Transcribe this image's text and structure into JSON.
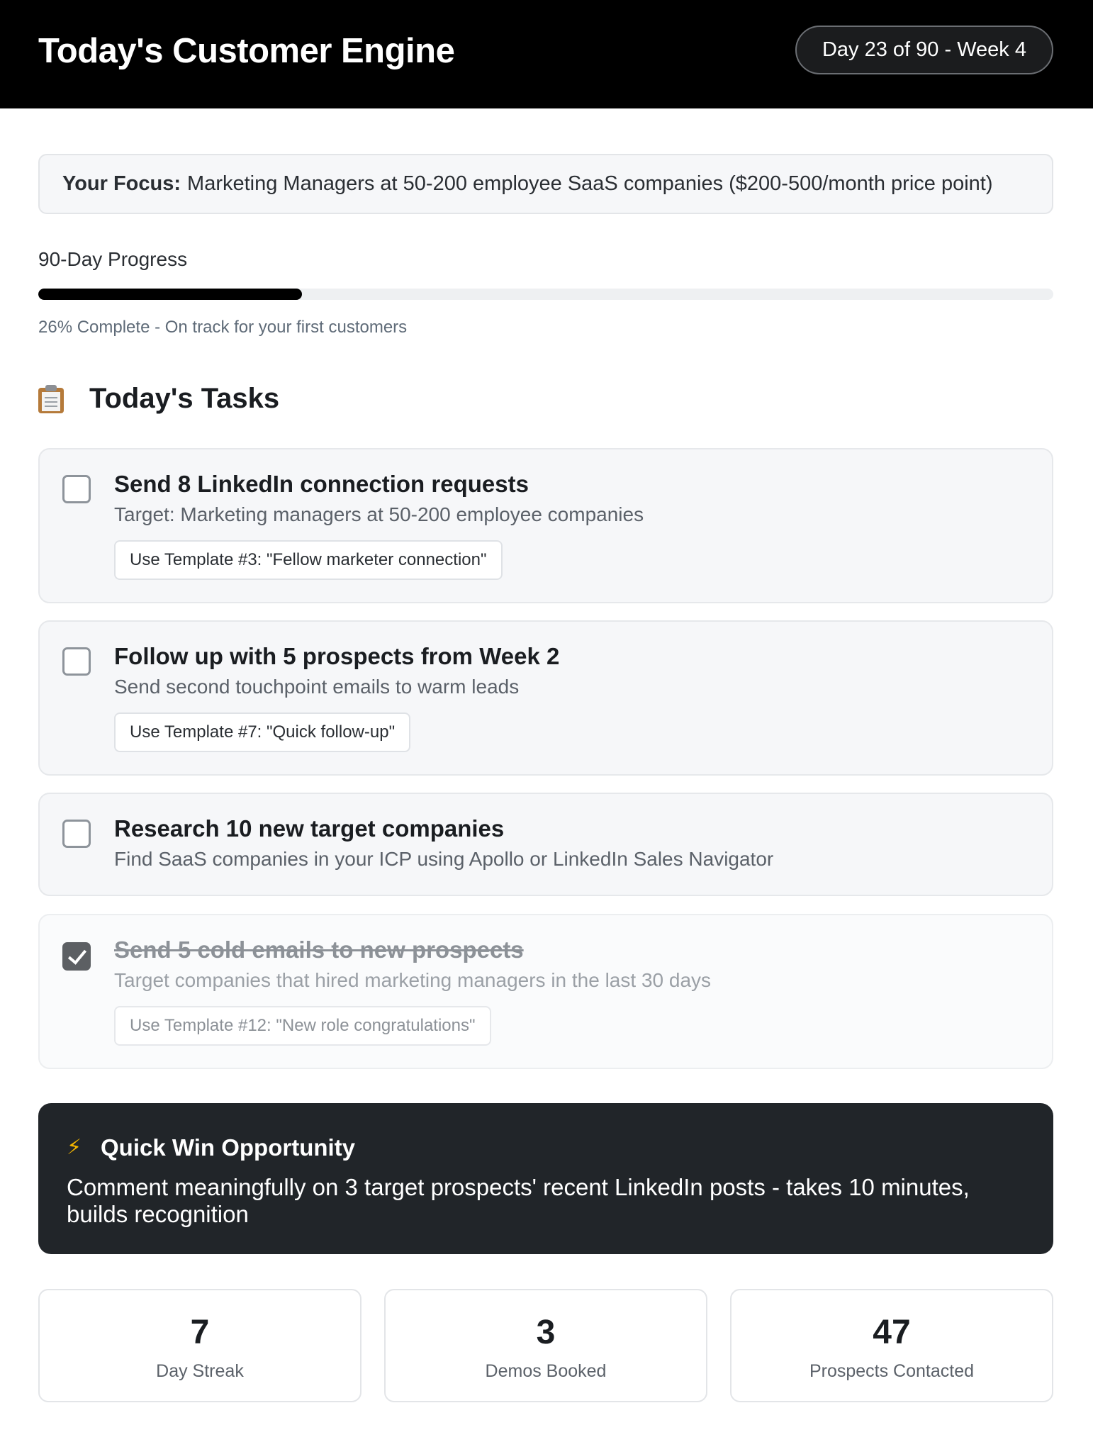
{
  "header": {
    "title": "Today's Customer Engine",
    "day_badge": "Day 23 of 90 - Week 4"
  },
  "focus": {
    "label": "Your Focus:",
    "text": "Marketing Managers at 50-200 employee SaaS companies ($200-500/month price point)"
  },
  "progress": {
    "label": "90-Day Progress",
    "percent": 26,
    "caption": "26% Complete - On track for your first customers"
  },
  "tasks_section": {
    "icon": "clipboard-icon",
    "title": "Today's Tasks"
  },
  "tasks": [
    {
      "title": "Send 8 LinkedIn connection requests",
      "description": "Target: Marketing managers at 50-200 employee companies",
      "template": "Use Template #3: \"Fellow marketer connection\"",
      "completed": false
    },
    {
      "title": "Follow up with 5 prospects from Week 2",
      "description": "Send second touchpoint emails to warm leads",
      "template": "Use Template #7: \"Quick follow-up\"",
      "completed": false
    },
    {
      "title": "Research 10 new target companies",
      "description": "Find SaaS companies in your ICP using Apollo or LinkedIn Sales Navigator",
      "completed": false
    },
    {
      "title": "Send 5 cold emails to new prospects",
      "description": "Target companies that hired marketing managers in the last 30 days",
      "template": "Use Template #12: \"New role congratulations\"",
      "completed": true
    }
  ],
  "quick_win": {
    "icon": "lightning-icon",
    "title": "Quick Win Opportunity",
    "text": "Comment meaningfully on 3 target prospects' recent LinkedIn posts - takes 10 minutes, builds recognition"
  },
  "stats": [
    {
      "value": "7",
      "label": "Day Streak"
    },
    {
      "value": "3",
      "label": "Demos Booked"
    },
    {
      "value": "47",
      "label": "Prospects Contacted"
    }
  ],
  "colors": {
    "header_bg": "#000000",
    "quick_win_bg": "#212529",
    "progress_fill": "#000000",
    "card_bg": "#f6f7f9"
  }
}
